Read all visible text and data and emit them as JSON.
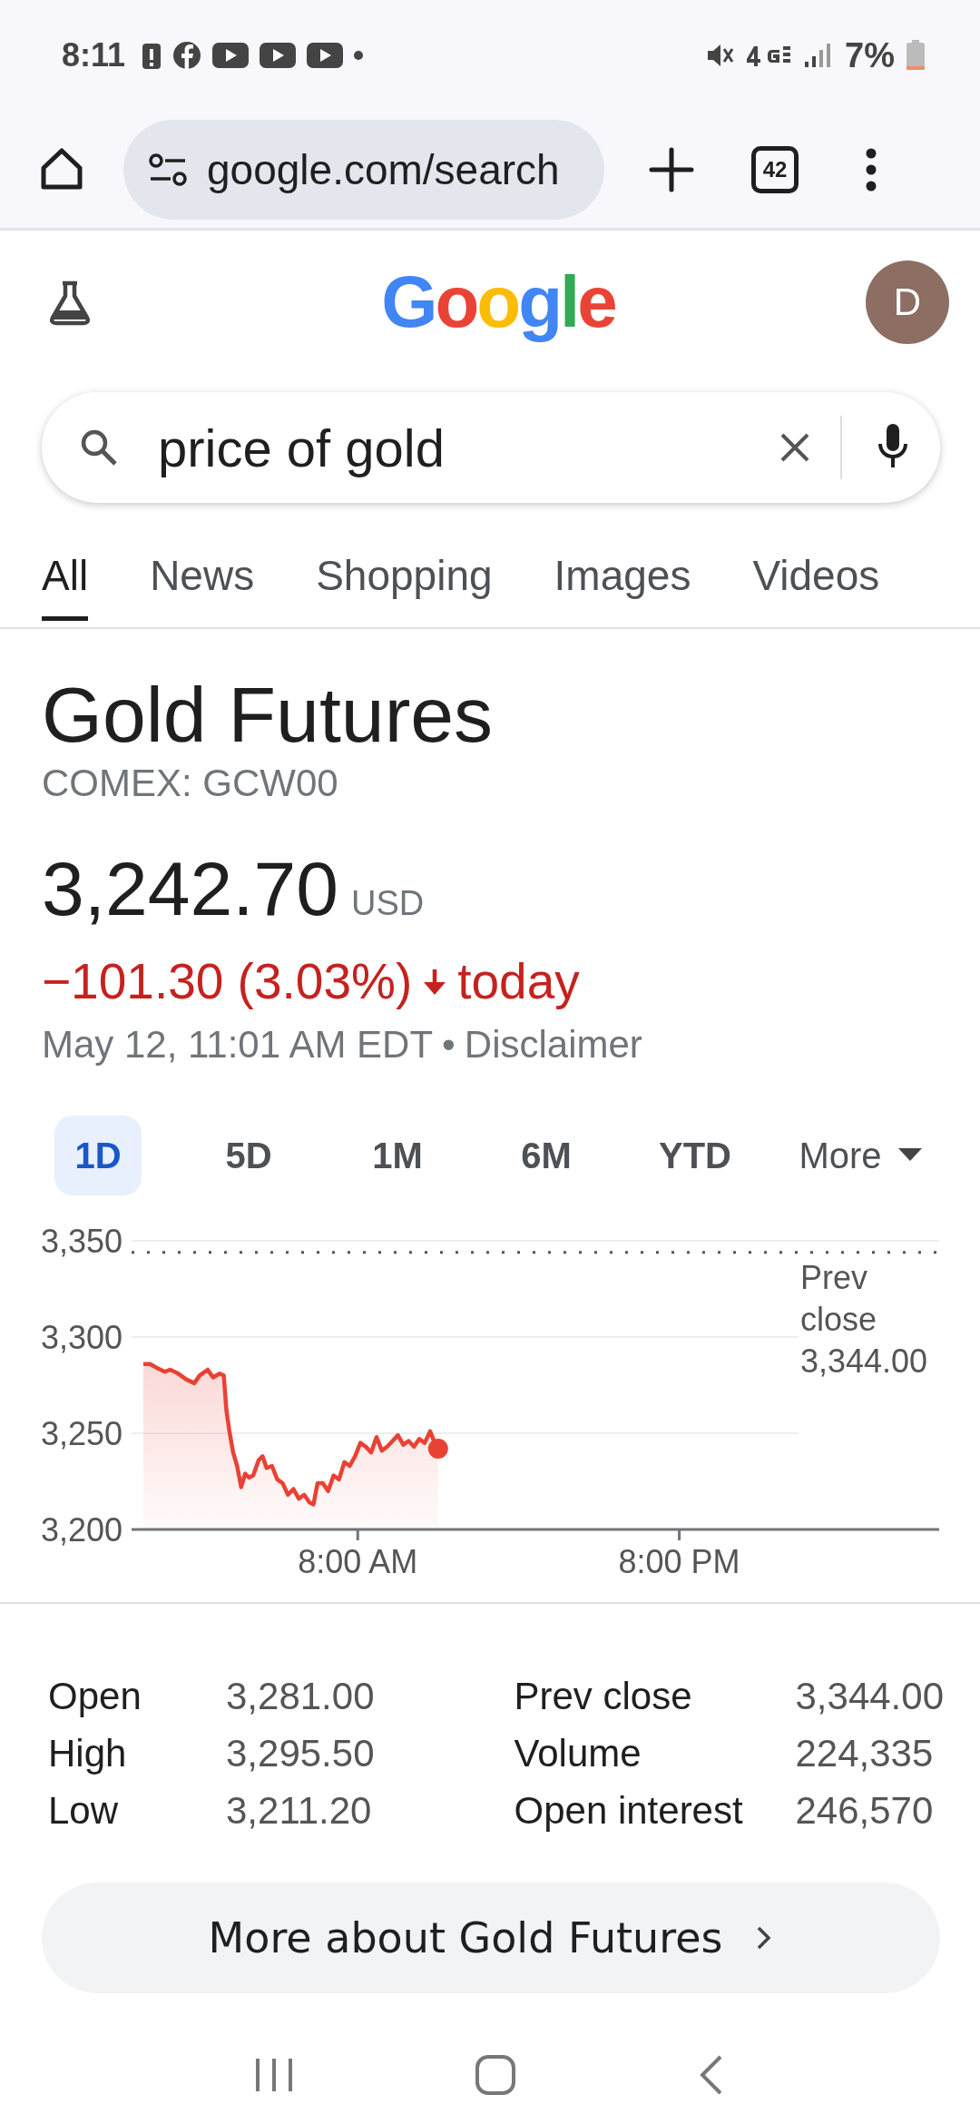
{
  "status_bar": {
    "time": "8:11",
    "battery": "7%"
  },
  "browser": {
    "url": "google.com/search",
    "tab_count": "42"
  },
  "header": {
    "logo": "Google",
    "avatar": "D"
  },
  "search": {
    "value": "price of gold"
  },
  "tabs": [
    {
      "label": "All",
      "selected": true
    },
    {
      "label": "News",
      "selected": false
    },
    {
      "label": "Shopping",
      "selected": false
    },
    {
      "label": "Images",
      "selected": false
    },
    {
      "label": "Videos",
      "selected": false
    }
  ],
  "quote": {
    "title": "Gold Futures",
    "symbol": "COMEX: GCW00",
    "price": "3,242.70",
    "currency": "USD",
    "change": "−101.30 (3.03%)",
    "change_suffix": "today",
    "timestamp": "May 12, 11:01 AM EDT",
    "separator": "•",
    "disclaimer": "Disclaimer"
  },
  "ranges": [
    {
      "label": "1D",
      "selected": true
    },
    {
      "label": "5D",
      "selected": false
    },
    {
      "label": "1M",
      "selected": false
    },
    {
      "label": "6M",
      "selected": false
    },
    {
      "label": "YTD",
      "selected": false
    },
    {
      "label": "More",
      "selected": false
    }
  ],
  "chart_data": {
    "type": "area",
    "xlim": [
      -0.44,
      29.7
    ],
    "ylim": [
      3200,
      3350
    ],
    "xticks": [
      {
        "value": 8,
        "label": "8:00 AM"
      },
      {
        "value": 20,
        "label": "8:00 PM"
      }
    ],
    "yticks": [
      {
        "value": 3200,
        "label": "3,200"
      },
      {
        "value": 3250,
        "label": "3,250"
      },
      {
        "value": 3300,
        "label": "3,300"
      },
      {
        "value": 3350,
        "label": "3,350"
      }
    ],
    "x": [
      0,
      0.25,
      0.5,
      0.8,
      1.0,
      1.3,
      1.6,
      1.9,
      2.1,
      2.4,
      2.6,
      2.85,
      3.0,
      3.1,
      3.2,
      3.35,
      3.5,
      3.65,
      3.8,
      3.95,
      4.1,
      4.3,
      4.45,
      4.6,
      4.8,
      5.0,
      5.2,
      5.4,
      5.6,
      5.8,
      6.0,
      6.2,
      6.35,
      6.5,
      6.7,
      6.9,
      7.1,
      7.3,
      7.5,
      7.7,
      7.9,
      8.1,
      8.3,
      8.5,
      8.7,
      8.9,
      9.1,
      9.3,
      9.5,
      9.7,
      9.9,
      10.1,
      10.3,
      10.5,
      10.7,
      10.9,
      11.0
    ],
    "series": [
      {
        "color": "#e94235",
        "values": [
          3286,
          3286,
          3284,
          3282,
          3283,
          3281,
          3278,
          3276,
          3280,
          3283,
          3279,
          3281,
          3280,
          3262,
          3252,
          3240,
          3233,
          3222,
          3229,
          3227,
          3228,
          3236,
          3238,
          3232,
          3233,
          3226,
          3224,
          3218,
          3221,
          3216,
          3218,
          3214,
          3213,
          3224,
          3224,
          3220,
          3228,
          3226,
          3235,
          3233,
          3238,
          3245,
          3243,
          3240,
          3248,
          3241,
          3243,
          3246,
          3249,
          3244,
          3246,
          3243,
          3247,
          3245,
          3251,
          3244,
          3242
        ]
      }
    ],
    "ref_lines": [
      {
        "axis": "y",
        "value": 3344,
        "label": "Prev close 3,344.00"
      }
    ]
  },
  "stats": [
    {
      "label": "Open",
      "value": "3,281.00"
    },
    {
      "label": "High",
      "value": "3,295.50"
    },
    {
      "label": "Low",
      "value": "3,211.20"
    },
    {
      "label": "Prev close",
      "value": "3,344.00"
    },
    {
      "label": "Volume",
      "value": "224,335"
    },
    {
      "label": "Open interest",
      "value": "246,570"
    }
  ],
  "more_button": {
    "label": "More about Gold Futures"
  }
}
